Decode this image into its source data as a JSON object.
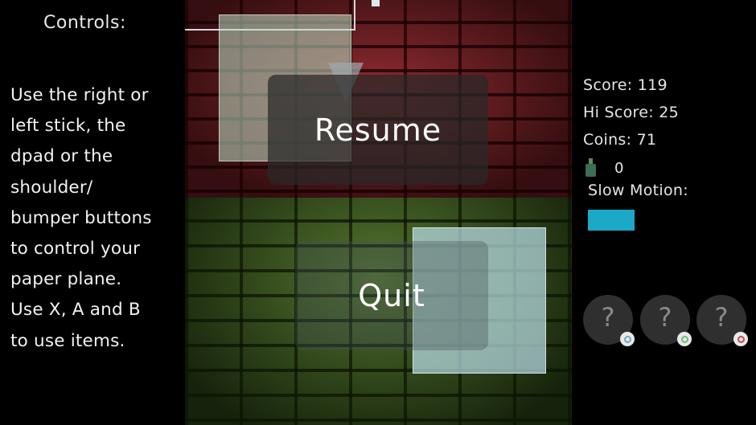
{
  "controls": {
    "title": "Controls:",
    "lines": [
      "Use the right or",
      "left stick, the",
      "dpad or the",
      "shoulder/",
      "bumper buttons",
      "to control your",
      "paper plane.",
      "Use X, A and B",
      "to use items."
    ]
  },
  "menu": {
    "resume_label": "Resume",
    "quit_label": "Quit"
  },
  "hud": {
    "score": "Score: 119",
    "hi_score": "Hi Score: 25",
    "coins": "Coins: 71",
    "potion_count": "0",
    "slow_motion_label": "Slow Motion:",
    "slow_motion_level": 1.0,
    "slow_motion_color": "#1ba9c8",
    "item_slots": [
      {
        "symbol": "?",
        "button_color": "#6fa8c8",
        "icon": "x-button-icon"
      },
      {
        "symbol": "?",
        "button_color": "#6fbf6f",
        "icon": "a-button-icon"
      },
      {
        "symbol": "?",
        "button_color": "#c84a4a",
        "icon": "b-button-icon"
      }
    ]
  },
  "colors": {
    "wall_red": "#7a2227",
    "wall_green": "#3f5a22"
  }
}
